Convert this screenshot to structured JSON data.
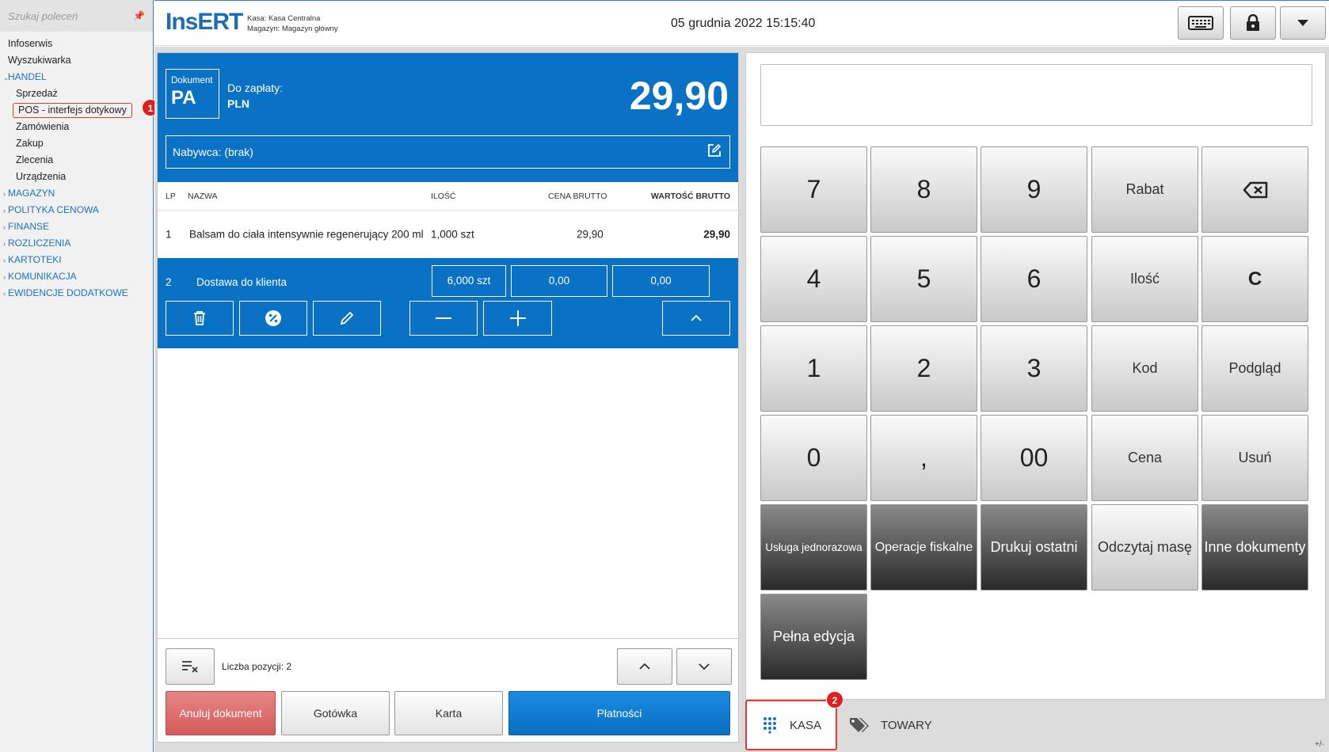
{
  "sidebar": {
    "search_placeholder": "Szukaj poleceń",
    "items": [
      {
        "label": "Infoserwis"
      },
      {
        "label": "Wyszukiwarka"
      },
      {
        "label": "HANDEL"
      },
      {
        "label": "Sprzedaż"
      },
      {
        "label": "POS - interfejs dotykowy"
      },
      {
        "label": "Zamówienia"
      },
      {
        "label": "Zakup"
      },
      {
        "label": "Zlecenia"
      },
      {
        "label": "Urządzenia"
      },
      {
        "label": "MAGAZYN"
      },
      {
        "label": "POLITYKA CENOWA"
      },
      {
        "label": "FINANSE"
      },
      {
        "label": "ROZLICZENIA"
      },
      {
        "label": "KARTOTEKI"
      },
      {
        "label": "KOMUNIKACJA"
      },
      {
        "label": "EWIDENCJE DODATKOWE"
      }
    ],
    "badge1": "1"
  },
  "header": {
    "logo": "InsERT",
    "kasa_label": "Kasa:",
    "kasa_value": "Kasa Centralna",
    "magazyn_label": "Magazyn:",
    "magazyn_value": "Magazyn główny",
    "datetime": "05 grudnia 2022 15:15:40",
    "buttons": [
      "keyboard-icon",
      "lock-icon",
      "dropdown-icon"
    ]
  },
  "document": {
    "type_label": "Dokument",
    "type_code": "PA",
    "to_pay_label": "Do zapłaty:",
    "currency": "PLN",
    "amount": "29,90",
    "buyer": "Nabywca: (brak)",
    "columns": {
      "lp": "LP",
      "name": "NAZWA",
      "qty": "ILOŚĆ",
      "price": "CENA BRUTTO",
      "value": "WARTOŚĆ BRUTTO"
    },
    "rows": [
      {
        "lp": "1",
        "name": "Balsam do ciała intensywnie regenerujący 200 ml",
        "qty": "1,000 szt",
        "price": "29,90",
        "value": "29,90"
      },
      {
        "lp": "2",
        "name": "Dostawa do klienta",
        "qty": "6,000 szt",
        "price": "0,00",
        "value": "0,00"
      }
    ],
    "items_count_label": "Liczba pozycji: 2",
    "buttons": {
      "cancel": "Anuluj dokument",
      "cash": "Gotówka",
      "card": "Karta",
      "payments": "Płatności"
    }
  },
  "keypad": {
    "rows": [
      [
        "7",
        "8",
        "9",
        "Rabat",
        ""
      ],
      [
        "4",
        "5",
        "6",
        "Ilość",
        "C"
      ],
      [
        "1",
        "2",
        "3",
        "Kod",
        "Podgląd"
      ],
      [
        "0",
        ",",
        "00",
        "Cena",
        "Usuń"
      ],
      [
        "Usługa jednorazowa",
        "Operacje fiskalne",
        "Drukuj ostatni",
        "Odczytaj masę",
        "Inne dokumenty"
      ],
      [
        "Pełna edycja"
      ]
    ]
  },
  "tabs": {
    "kasa": "KASA",
    "towary": "TOWARY",
    "badge2": "2",
    "corner": "+/-"
  }
}
